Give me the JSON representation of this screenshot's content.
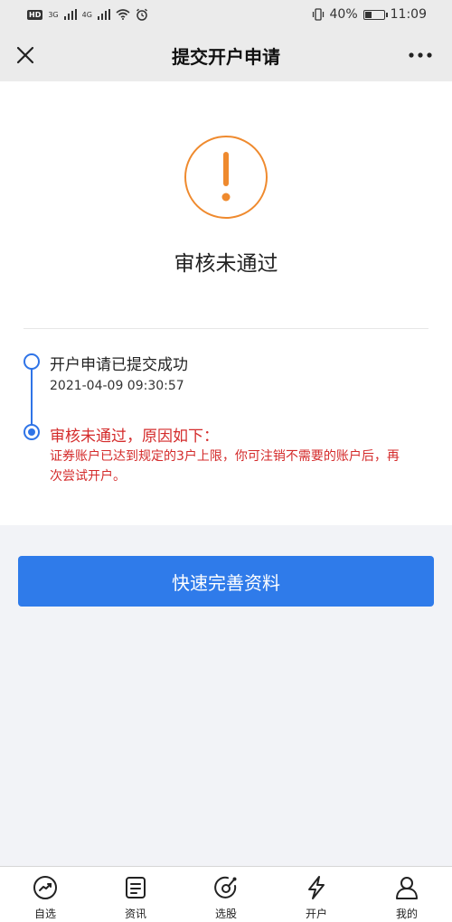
{
  "status_bar": {
    "hd_badge": "HD",
    "network_3g": "3G",
    "network_4g": "4G",
    "battery_percent": "40%",
    "time": "11:09",
    "battery_level": 0.4
  },
  "nav": {
    "title": "提交开户申请",
    "close_icon": "close-icon",
    "more_icon": "more-icon"
  },
  "result": {
    "icon": "warning-icon",
    "accent_color": "#ef8a2e",
    "title": "审核未通过"
  },
  "timeline": {
    "steps": [
      {
        "title": "开户申请已提交成功",
        "time": "2021-04-09 09:30:57",
        "status": "done"
      },
      {
        "title": "审核未通过，原因如下：",
        "desc": "证券账户已达到规定的3户上限，你可注销不需要的账户后，再次尝试开户。",
        "status": "failed"
      }
    ],
    "line_color": "#2f74e7",
    "error_color": "#d42b2b"
  },
  "action": {
    "label": "快速完善资料",
    "color": "#2f7bea"
  },
  "tabbar": {
    "items": [
      {
        "label": "自选",
        "icon": "trend-icon"
      },
      {
        "label": "资讯",
        "icon": "news-icon"
      },
      {
        "label": "选股",
        "icon": "stock-picker-icon"
      },
      {
        "label": "开户",
        "icon": "lightning-icon"
      },
      {
        "label": "我的",
        "icon": "user-icon"
      }
    ]
  }
}
